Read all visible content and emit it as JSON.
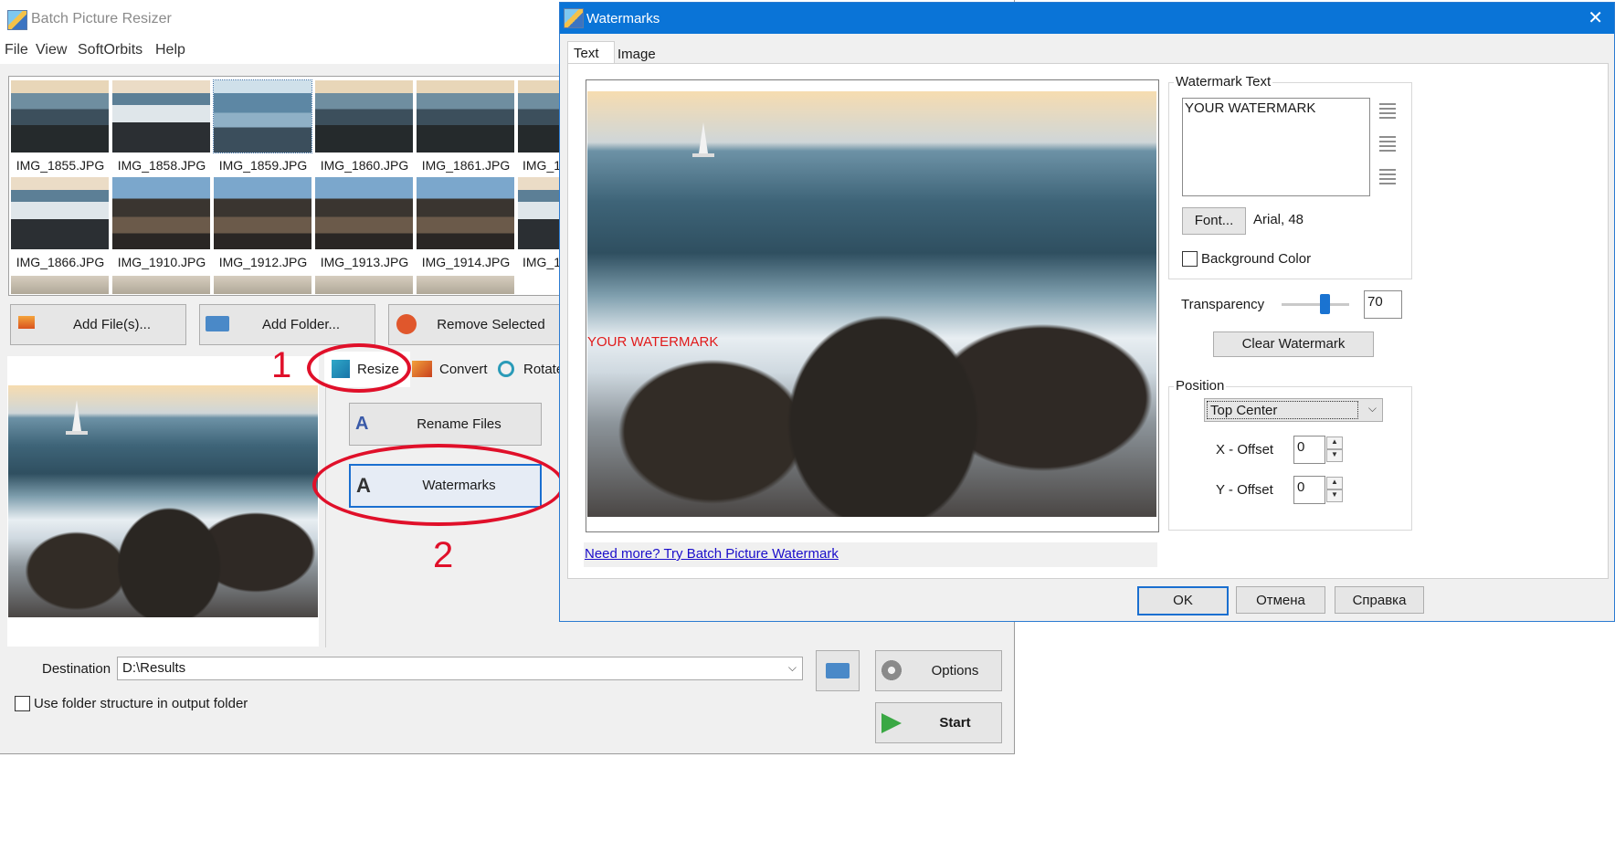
{
  "main": {
    "title": "Batch Picture Resizer",
    "menu": [
      "File",
      "View",
      "SoftOrbits",
      "Help"
    ],
    "thumbnails": [
      "IMG_1855.JPG",
      "IMG_1858.JPG",
      "IMG_1859.JPG",
      "IMG_1860.JPG",
      "IMG_1861.JPG",
      "IMG_1",
      "IMG_1866.JPG",
      "IMG_1910.JPG",
      "IMG_1912.JPG",
      "IMG_1913.JPG",
      "IMG_1914.JPG",
      "IMG_1"
    ],
    "buttons": {
      "add_files": "Add File(s)...",
      "add_folder": "Add Folder...",
      "remove_selected": "Remove Selected"
    },
    "tabs": [
      "Resize",
      "Convert",
      "Rotate"
    ],
    "actions": {
      "rename_files": "Rename Files",
      "watermarks": "Watermarks"
    },
    "annotations": {
      "step1": "1",
      "step2": "2",
      "annotation_color": "#e0102a"
    },
    "destination": {
      "label": "Destination",
      "value": "D:\\Results"
    },
    "use_folder_structure": "Use folder structure in output folder",
    "options": "Options",
    "start": "Start"
  },
  "dialog": {
    "title": "Watermarks",
    "close": "✕",
    "tabs": [
      "Text",
      "Image"
    ],
    "preview_watermark": "YOUR WATERMARK",
    "link": "Need more? Try Batch Picture Watermark",
    "watermark_text": {
      "group": "Watermark Text",
      "value": "YOUR WATERMARK",
      "font_button": "Font...",
      "font_value": "Arial, 48",
      "background_color": "Background Color"
    },
    "transparency": {
      "label": "Transparency",
      "value": "70",
      "level": 0.7
    },
    "clear_watermark": "Clear Watermark",
    "position": {
      "group": "Position",
      "selected": "Top Center",
      "x_offset_label": "X - Offset",
      "x_offset": "0",
      "y_offset_label": "Y - Offset",
      "y_offset": "0"
    },
    "footer": {
      "ok": "OK",
      "cancel": "Отмена",
      "help": "Справка"
    },
    "accent": "#0a74d7"
  }
}
